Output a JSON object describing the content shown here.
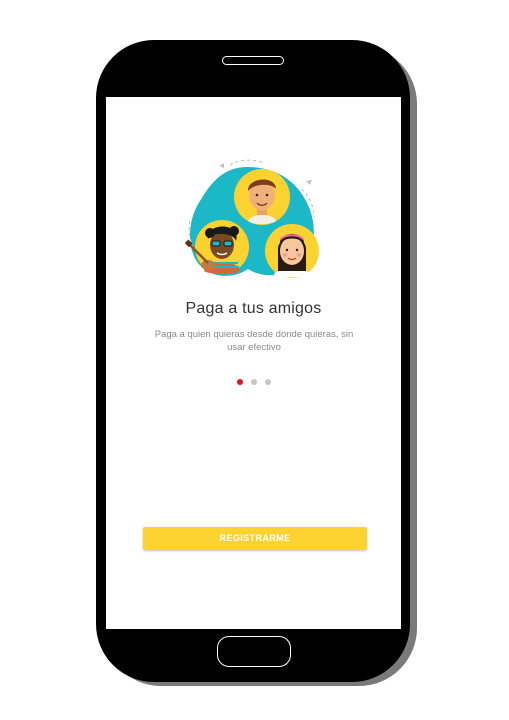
{
  "onboarding": {
    "title": "Paga a tus amigos",
    "description": "Paga a quien quieras desde donde quieras, sin usar efectivo",
    "page_indicator": {
      "total_pages": 3,
      "active_page": 1
    },
    "register_button_label": "REGISTRARME"
  },
  "colors": {
    "accent_yellow": "#FCD230",
    "active_dot": "#E4141E",
    "inactive_dot": "#C7C7C7",
    "illustration_teal": "#1CB8C8"
  },
  "icons": {
    "illustration": "friends-illustration"
  }
}
